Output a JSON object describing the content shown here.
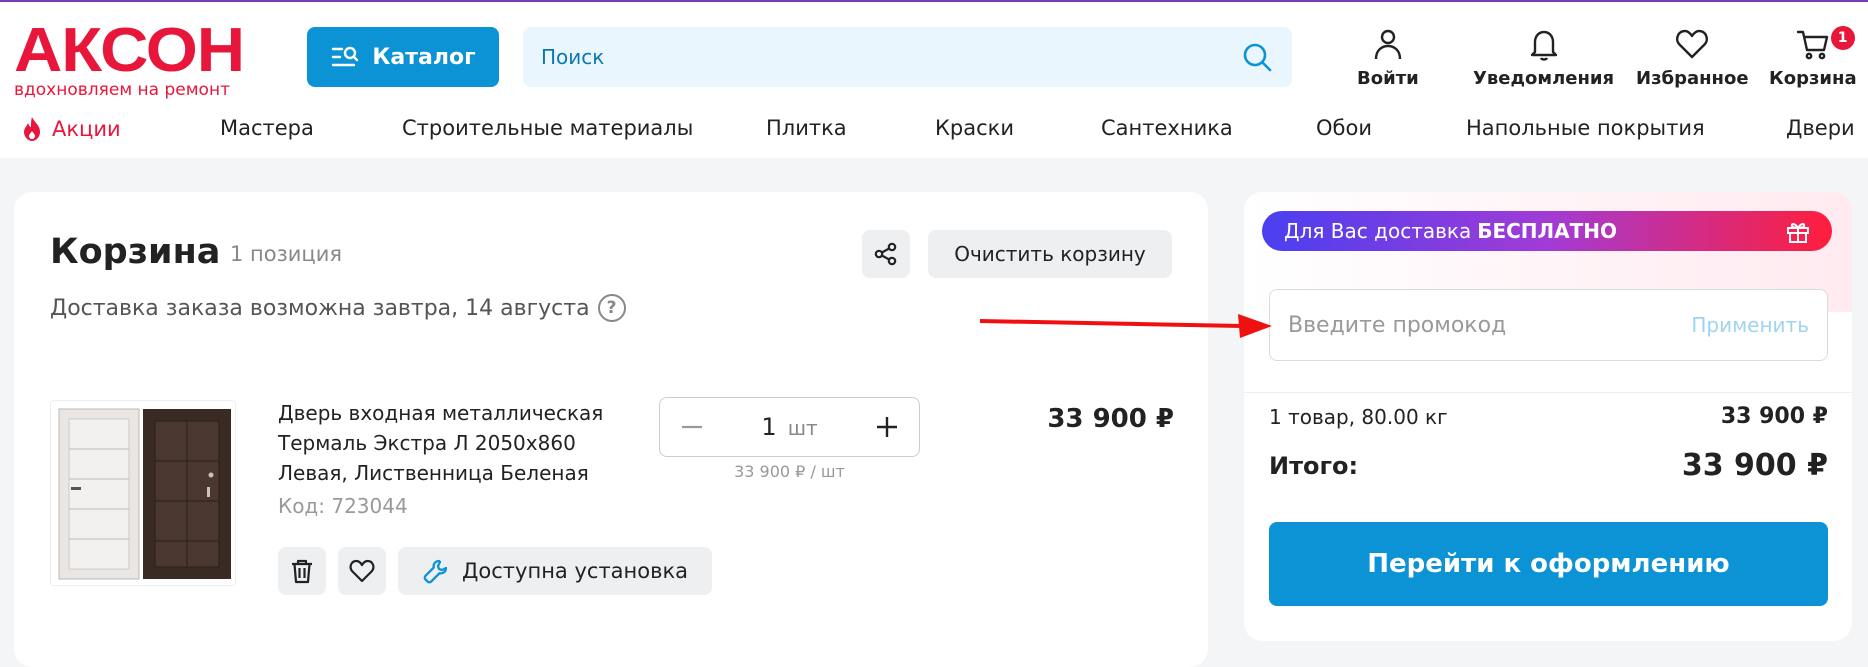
{
  "brand": {
    "name": "АКСОН",
    "slogan": "вдохновляем на ремонт",
    "color": "#e8163a",
    "accent": "#0b93d6"
  },
  "header": {
    "catalog_label": "Каталог",
    "search_placeholder": "Поиск",
    "actions": {
      "login": "Войти",
      "notifications": "Уведомления",
      "favorites": "Избранное",
      "cart": "Корзина",
      "cart_count": "1"
    }
  },
  "nav": {
    "promo": "Акции",
    "items": [
      "Мастера",
      "Строительные материалы",
      "Плитка",
      "Краски",
      "Сантехника",
      "Обои",
      "Напольные покрытия",
      "Двери"
    ]
  },
  "cart": {
    "title": "Корзина",
    "count": "1 позиция",
    "delivery_note": "Доставка заказа возможна завтра, 14 августа",
    "help_icon": "?",
    "clear_label": "Очистить корзину",
    "item": {
      "name": "Дверь входная металлическая Термаль Экстра Л 2050х860 Левая, Лиственница Беленая",
      "code": "Код: 723044",
      "quantity": "1",
      "unit": "шт",
      "unit_price": "33 900 ₽ / шт",
      "price": "33 900 ₽",
      "install_label": "Доступна установка"
    }
  },
  "summary": {
    "free_delivery_text": "Для Вас доставка",
    "free_delivery_bold": "БЕСПЛАТНО",
    "promo_placeholder": "Введите промокод",
    "promo_apply": "Применить",
    "items_label": "1 товар, 80.00 кг",
    "items_value": "33 900 ₽",
    "total_label": "Итого:",
    "total_value": "33 900 ₽",
    "checkout_label": "Перейти к оформлению"
  }
}
